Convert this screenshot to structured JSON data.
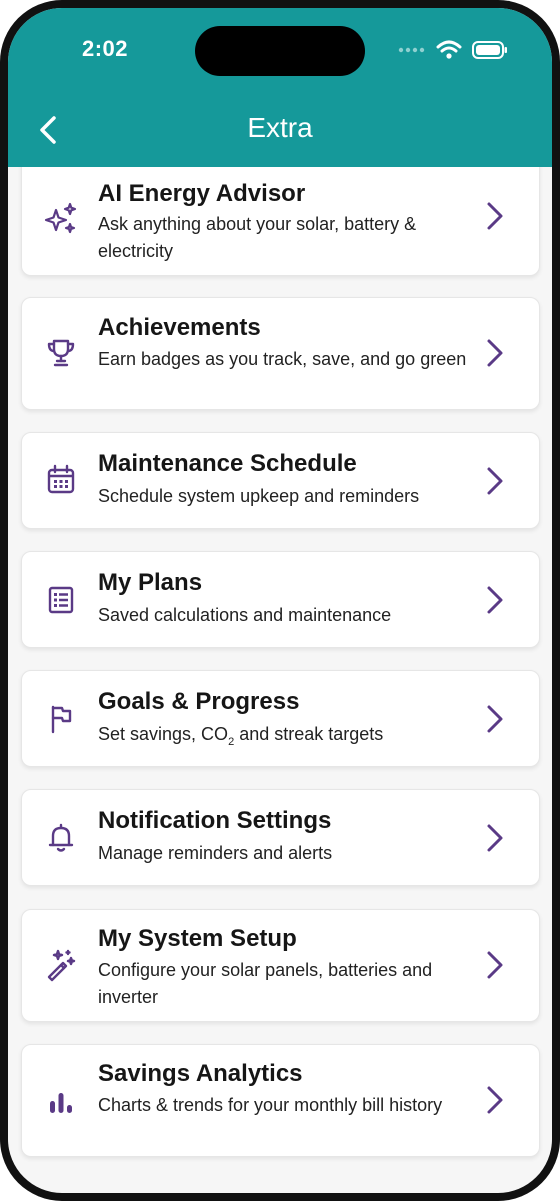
{
  "status_bar": {
    "time": "2:02"
  },
  "header": {
    "title": "Extra",
    "back_icon": "chevron-left-icon"
  },
  "colors": {
    "header": "#15999a",
    "accent": "#5a3a86",
    "background": "#f6f6f6"
  },
  "items": [
    {
      "title": "AI Energy Advisor",
      "description": "Ask anything about your solar, battery & electricity",
      "icon": "sparkles-icon"
    },
    {
      "title": "Achievements",
      "description": "Earn badges as you track, save, and go green",
      "icon": "trophy-icon"
    },
    {
      "title": "Maintenance Schedule",
      "description": "Schedule system upkeep and reminders",
      "icon": "calendar-icon"
    },
    {
      "title": "My Plans",
      "description": "Saved calculations and maintenance",
      "icon": "list-icon"
    },
    {
      "title": "Goals & Progress",
      "description_prefix": "Set savings, CO",
      "description_sub": "2",
      "description_suffix": " and streak targets",
      "icon": "flag-icon"
    },
    {
      "title": "Notification Settings",
      "description": "Manage reminders and alerts",
      "icon": "bell-icon"
    },
    {
      "title": "My System Setup",
      "description": "Configure your solar panels, batteries and inverter",
      "icon": "magic-wand-icon"
    },
    {
      "title": "Savings Analytics",
      "description": "Charts & trends for your monthly bill history",
      "icon": "bar-chart-icon"
    }
  ]
}
